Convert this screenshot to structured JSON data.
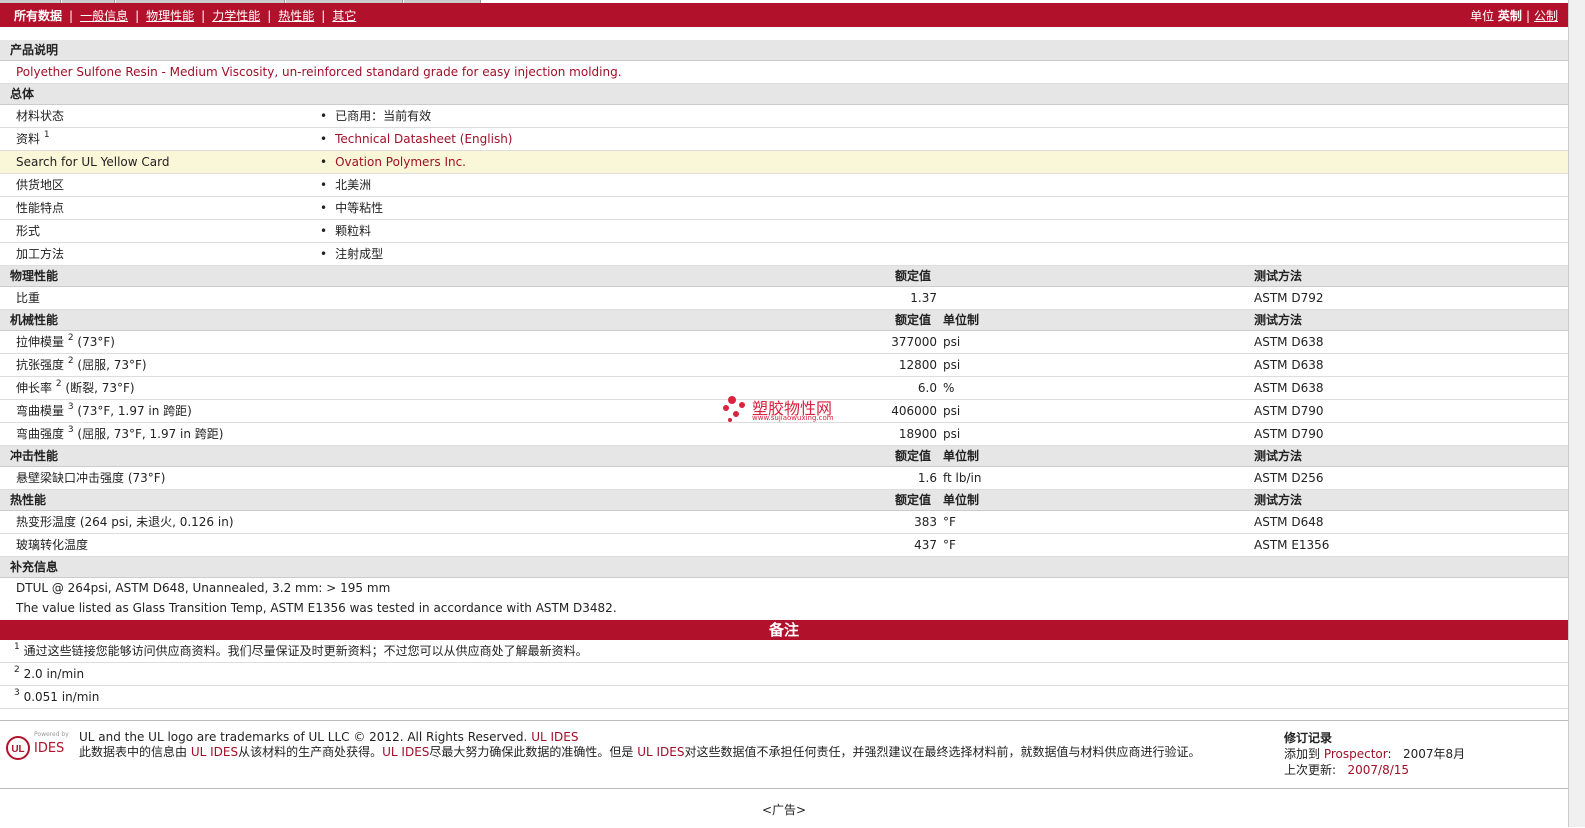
{
  "nav": {
    "tabs": [
      {
        "label": "所有数据",
        "current": true
      },
      {
        "label": "一般信息"
      },
      {
        "label": "物理性能"
      },
      {
        "label": "力学性能"
      },
      {
        "label": "热性能"
      },
      {
        "label": "其它"
      }
    ],
    "units_label": "单位",
    "units_current": "英制",
    "units_other": "公制",
    "sep": "|"
  },
  "product": {
    "title": "产品说明",
    "description": "Polyether Sulfone Resin - Medium Viscosity, un-reinforced standard grade for easy injection molding."
  },
  "general": {
    "title": "总体",
    "rows": [
      {
        "label": "材料状态",
        "sup": "",
        "value": "已商用：当前有效",
        "link": false,
        "highlight": false
      },
      {
        "label": "资料",
        "sup": "1",
        "value": "Technical Datasheet (English)",
        "link": true,
        "highlight": false
      },
      {
        "label": "Search for UL Yellow Card",
        "sup": "",
        "value": "Ovation Polymers Inc.",
        "link": true,
        "highlight": true
      },
      {
        "label": "供货地区",
        "sup": "",
        "value": "北美洲",
        "link": false,
        "highlight": false
      },
      {
        "label": "性能特点",
        "sup": "",
        "value": "中等粘性",
        "link": false,
        "highlight": false
      },
      {
        "label": "形式",
        "sup": "",
        "value": "颗粒料",
        "link": false,
        "highlight": false
      },
      {
        "label": "加工方法",
        "sup": "",
        "value": "注射成型",
        "link": false,
        "highlight": false
      }
    ],
    "bullet": "•"
  },
  "sections": [
    {
      "title": "物理性能",
      "h_value": "额定值",
      "h_unit": "",
      "h_test": "测试方法",
      "rows": [
        {
          "label": "比重",
          "sup": "",
          "cond": "",
          "value": "1.37",
          "unit": "",
          "test": "ASTM D792"
        }
      ]
    },
    {
      "title": "机械性能",
      "h_value": "额定值",
      "h_unit": "单位制",
      "h_test": "测试方法",
      "rows": [
        {
          "label": "拉伸模量",
          "sup": "2",
          "cond": "(73°F)",
          "value": "377000",
          "unit": "psi",
          "test": "ASTM D638"
        },
        {
          "label": "抗张强度",
          "sup": "2",
          "cond": "(屈服, 73°F)",
          "value": "12800",
          "unit": "psi",
          "test": "ASTM D638"
        },
        {
          "label": "伸长率",
          "sup": "2",
          "cond": "(断裂, 73°F)",
          "value": "6.0",
          "unit": "%",
          "test": "ASTM D638"
        },
        {
          "label": "弯曲模量",
          "sup": "3",
          "cond": "(73°F, 1.97 in 跨距)",
          "value": "406000",
          "unit": "psi",
          "test": "ASTM D790"
        },
        {
          "label": "弯曲强度",
          "sup": "3",
          "cond": "(屈服, 73°F, 1.97 in 跨距)",
          "value": "18900",
          "unit": "psi",
          "test": "ASTM D790"
        }
      ]
    },
    {
      "title": "冲击性能",
      "h_value": "额定值",
      "h_unit": "单位制",
      "h_test": "测试方法",
      "rows": [
        {
          "label": "悬壁梁缺口冲击强度",
          "sup": "",
          "cond": "(73°F)",
          "value": "1.6",
          "unit": "ft lb/in",
          "test": "ASTM D256"
        }
      ]
    },
    {
      "title": "热性能",
      "h_value": "额定值",
      "h_unit": "单位制",
      "h_test": "测试方法",
      "rows": [
        {
          "label": "热变形温度",
          "sup": "",
          "cond": "(264 psi, 未退火, 0.126 in)",
          "value": "383",
          "unit": "°F",
          "test": "ASTM D648"
        },
        {
          "label": "玻璃转化温度",
          "sup": "",
          "cond": "",
          "value": "437",
          "unit": "°F",
          "test": "ASTM E1356"
        }
      ]
    }
  ],
  "supplement": {
    "title": "补充信息",
    "lines": [
      "DTUL @ 264psi, ASTM D648, Unannealed, 3.2 mm: > 195 mm",
      "The value listed as Glass Transition Temp, ASTM E1356 was tested in accordance with ASTM D3482."
    ]
  },
  "notes": {
    "title": "备注",
    "items": [
      {
        "n": "1",
        "text": "通过这些链接您能够访问供应商资料。我们尽量保证及时更新资料；不过您可以从供应商处了解最新资料。"
      },
      {
        "n": "2",
        "text": "2.0 in/min"
      },
      {
        "n": "3",
        "text": "0.051 in/min"
      }
    ]
  },
  "watermark": {
    "cn": "塑胶物性网",
    "url": "www.sujiaowuxing.com"
  },
  "footer": {
    "logo_small": "Powered by",
    "logo_text": "IDES",
    "trademark": "UL and the UL logo are trademarks of UL LLC © 2012. All Rights Reserved.",
    "trademark_link": "UL IDES",
    "disclaimer_1": "此数据表中的信息由",
    "disclaimer_link1": "UL IDES",
    "disclaimer_2": "从该材料的生产商处获得。",
    "disclaimer_link2": "UL IDES",
    "disclaimer_3": "尽最大努力确保此数据的准确性。但是",
    "disclaimer_link3": "UL IDES",
    "disclaimer_4": "对这些数据值不承担任何责任，并强烈建议在最终选择材料前，就数据值与材料供应商进行验证。",
    "revision_title": "修订记录",
    "added_label": "添加到",
    "added_link": "Prospector",
    "added_date": "2007年8月",
    "updated_label": "上次更新:",
    "updated_date": "2007/8/15"
  },
  "ad": "<广告>",
  "colors": {
    "brand": "#b1112a",
    "link": "#a00f28",
    "highlight": "#faf6d8",
    "section_bg": "#e6e6e6"
  }
}
